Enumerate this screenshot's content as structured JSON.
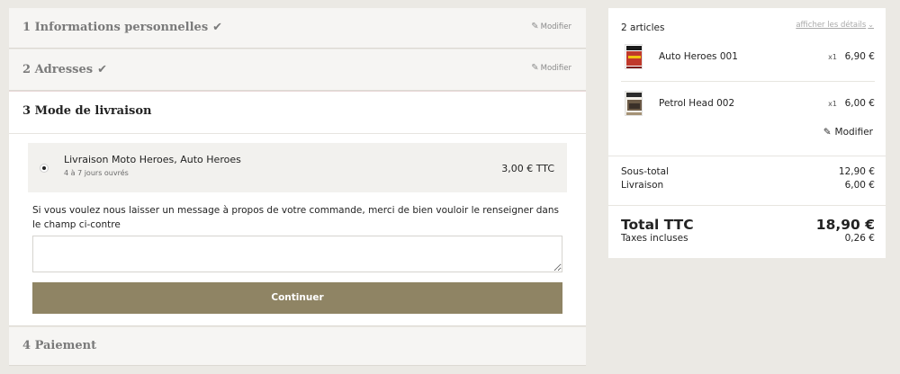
{
  "checkout": {
    "step1": {
      "title": "1 Informations personnelles",
      "edit_label": "Modifier"
    },
    "step2": {
      "title": "2 Adresses",
      "edit_label": "Modifier"
    },
    "step3": {
      "title": "3 Mode de livraison",
      "carrier": {
        "name": "Livraison Moto Heroes, Auto Heroes",
        "delay": "4 à 7 jours ouvrés",
        "price": "3,00 € TTC",
        "selected": true
      },
      "message_label": "Si vous voulez nous laisser un message à propos de votre commande, merci de bien vouloir le renseigner dans le champ ci-contre",
      "message_value": "",
      "continue_label": "Continuer"
    },
    "step4": {
      "title": "4 Paiement"
    }
  },
  "cart": {
    "items_count": "2 articles",
    "show_details": "afficher les détails",
    "products": [
      {
        "name": "Auto Heroes 001",
        "qty": "x1",
        "price": "6,90 €",
        "thumb_color": "#c0392b"
      },
      {
        "name": "Petrol Head 002",
        "qty": "x1",
        "price": "6,00 €",
        "thumb_color": "#5a4a3a"
      }
    ],
    "edit_label": "Modifier",
    "subtotal_label": "Sous-total",
    "subtotal_value": "12,90 €",
    "shipping_label": "Livraison",
    "shipping_value": "6,00 €",
    "total_label": "Total TTC",
    "total_value": "18,90 €",
    "tax_label": "Taxes incluses",
    "tax_value": "0,26 €"
  },
  "colors": {
    "accent": "#8f8464",
    "background": "#ebe9e4"
  },
  "icons": {
    "check": "check-icon",
    "pencil": "pencil-icon",
    "chevron": "chevron-down-icon"
  }
}
